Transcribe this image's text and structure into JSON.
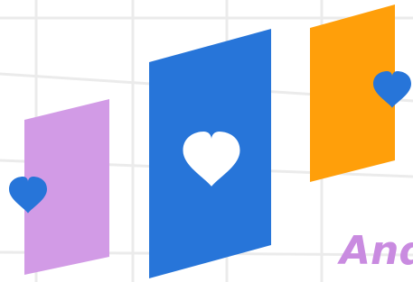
{
  "illustration": {
    "colors": {
      "background": "#ffffff",
      "grid": "#ebebeb",
      "card_lavender": "#d29be6",
      "card_blue": "#2775d9",
      "card_orange": "#ff9f0a",
      "heart_blue": "#2775d9",
      "heart_white": "#ffffff",
      "text_accent": "#c98be0"
    },
    "cards": [
      {
        "name": "card-lavender",
        "color": "card_lavender",
        "heart_icon": "heart-icon",
        "heart_color": "heart_blue"
      },
      {
        "name": "card-blue",
        "color": "card_blue",
        "heart_icon": "heart-icon",
        "heart_color": "heart_white"
      },
      {
        "name": "card-orange",
        "color": "card_orange",
        "heart_icon": "heart-icon",
        "heart_color": "heart_blue"
      }
    ],
    "cropped_text": "And"
  }
}
